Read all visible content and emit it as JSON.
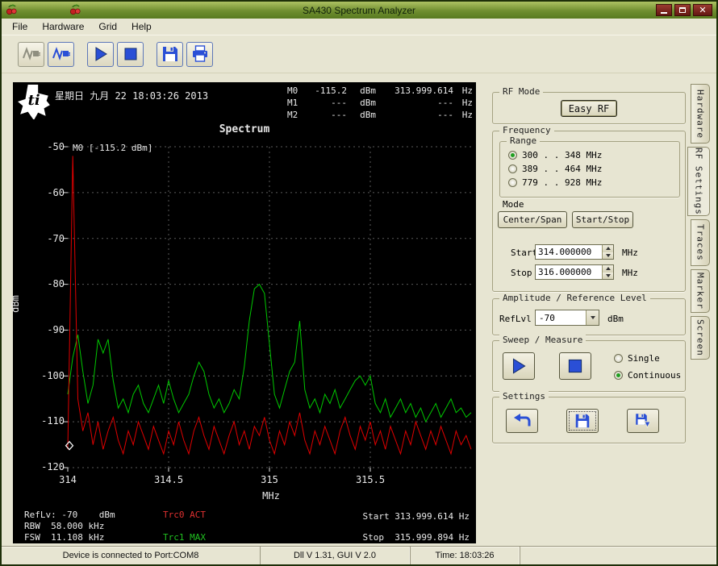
{
  "window": {
    "title": "SA430 Spectrum Analyzer"
  },
  "menu": {
    "items": [
      "File",
      "Hardware",
      "Grid",
      "Help"
    ]
  },
  "plot": {
    "datetime": "星期日 九月 22 18:03:26 2013",
    "title": "Spectrum",
    "annotation": "M0 [-115.2 dBm]",
    "ylabel": "dBm",
    "xlabel": "MHz",
    "yticks": [
      "-50",
      "-60",
      "-70",
      "-80",
      "-90",
      "-100",
      "-110",
      "-120"
    ],
    "xticks": [
      "314",
      "314.5",
      "315",
      "315.5"
    ],
    "markers": [
      {
        "label": "M0",
        "level": "-115.2",
        "unit": "dBm",
        "freq": "313.999.614",
        "funit": "Hz"
      },
      {
        "label": "M1",
        "level": "---",
        "unit": "dBm",
        "freq": "---",
        "funit": "Hz"
      },
      {
        "label": "M2",
        "level": "---",
        "unit": "dBm",
        "freq": "---",
        "funit": "Hz"
      }
    ],
    "footer": {
      "reflv": "RefLv: -70    dBm",
      "rbw": "RBW  58.000 kHz",
      "fsw": "FSW  11.108 kHz",
      "trc0": "Trc0 ACT",
      "trc1": "Trc1 MAX",
      "start": "Start 313.999.614 Hz",
      "stop": "Stop  315.999.894 Hz"
    }
  },
  "panel": {
    "rf_mode": {
      "title": "RF Mode",
      "easy_rf_label": "Easy RF"
    },
    "frequency": {
      "title": "Frequency",
      "range_title": "Range",
      "ranges": [
        {
          "label": "300 . . 348  MHz",
          "selected": true
        },
        {
          "label": "389 . . 464  MHz",
          "selected": false
        },
        {
          "label": "779 . . 928  MHz",
          "selected": false
        }
      ],
      "mode_label": "Mode",
      "center_span_label": "Center/Span",
      "start_stop_label": "Start/Stop",
      "start_label": "Start",
      "start_value": "314.000000",
      "start_unit": "MHz",
      "stop_label": "Stop",
      "stop_value": "316.000000",
      "stop_unit": "MHz"
    },
    "amplitude": {
      "title": "Amplitude / Reference Level",
      "reflvl_label": "RefLvl",
      "reflvl_value": "-70",
      "unit": "dBm"
    },
    "sweep": {
      "title": "Sweep / Measure",
      "single_label": "Single",
      "continuous_label": "Continuous",
      "single_selected": false,
      "continuous_selected": true
    },
    "settings": {
      "title": "Settings"
    }
  },
  "tabs": [
    {
      "label": "Hardware",
      "active": false
    },
    {
      "label": "RF Settings",
      "active": true
    },
    {
      "label": "Traces",
      "active": false
    },
    {
      "label": "Marker",
      "active": false
    },
    {
      "label": "Screen",
      "active": false
    }
  ],
  "statusbar": {
    "device": "Device is connected to Port:COM8",
    "version": "Dll V 1.31, GUI V 2.0",
    "time": "Time: 18:03:26"
  },
  "accent_colors": {
    "trace_active": "#e00000",
    "trace_max": "#00c800",
    "toolbar_icon": "#2a4fd6"
  },
  "chart_data": {
    "type": "line",
    "title": "Spectrum",
    "xlabel": "MHz",
    "ylabel": "dBm",
    "xlim": [
      314.0,
      316.0
    ],
    "ylim": [
      -120,
      -50
    ],
    "ygrid": [
      -50,
      -60,
      -70,
      -80,
      -90,
      -100,
      -110,
      -120
    ],
    "xgrid": [
      314.5,
      315.0,
      315.5
    ],
    "xticks": [
      314,
      314.5,
      315,
      315.5
    ],
    "grid": "dashed",
    "series": [
      {
        "name": "Trc1 MAX",
        "color": "#00c800",
        "x_start": 314.0,
        "x_step": 0.025,
        "values": [
          -104,
          -96,
          -91,
          -99,
          -106,
          -102,
          -92,
          -95,
          -92,
          -101,
          -107,
          -105,
          -108,
          -104,
          -102,
          -106,
          -108,
          -105,
          -102,
          -106,
          -101,
          -105,
          -108,
          -106,
          -104,
          -100,
          -97,
          -99,
          -104,
          -107,
          -105,
          -108,
          -106,
          -103,
          -105,
          -98,
          -88,
          -81,
          -80,
          -82,
          -93,
          -104,
          -107,
          -103,
          -99,
          -97,
          -88,
          -103,
          -107,
          -105,
          -108,
          -104,
          -106,
          -103,
          -107,
          -105,
          -103,
          -101,
          -100,
          -102,
          -100,
          -106,
          -108,
          -105,
          -109,
          -107,
          -105,
          -108,
          -106,
          -109,
          -107,
          -110,
          -108,
          -106,
          -109,
          -107,
          -105,
          -108,
          -107,
          -109,
          -108
        ]
      },
      {
        "name": "Trc0 ACT",
        "color": "#e00000",
        "x_start": 314.0,
        "x_step": 0.025,
        "values": [
          -116,
          -52,
          -105,
          -112,
          -108,
          -115,
          -110,
          -116,
          -112,
          -109,
          -114,
          -117,
          -112,
          -115,
          -110,
          -113,
          -116,
          -111,
          -114,
          -117,
          -112,
          -115,
          -110,
          -114,
          -117,
          -112,
          -109,
          -113,
          -116,
          -111,
          -114,
          -117,
          -113,
          -110,
          -115,
          -112,
          -116,
          -111,
          -113,
          -109,
          -114,
          -117,
          -112,
          -115,
          -110,
          -113,
          -108,
          -114,
          -117,
          -112,
          -115,
          -111,
          -114,
          -117,
          -112,
          -109,
          -113,
          -116,
          -111,
          -114,
          -110,
          -115,
          -112,
          -116,
          -111,
          -114,
          -117,
          -112,
          -115,
          -110,
          -113,
          -116,
          -112,
          -115,
          -111,
          -114,
          -117,
          -112,
          -115,
          -113,
          -116
        ]
      }
    ],
    "marker_point": {
      "x": 314.0,
      "y": -115.2,
      "label": "M0"
    }
  }
}
